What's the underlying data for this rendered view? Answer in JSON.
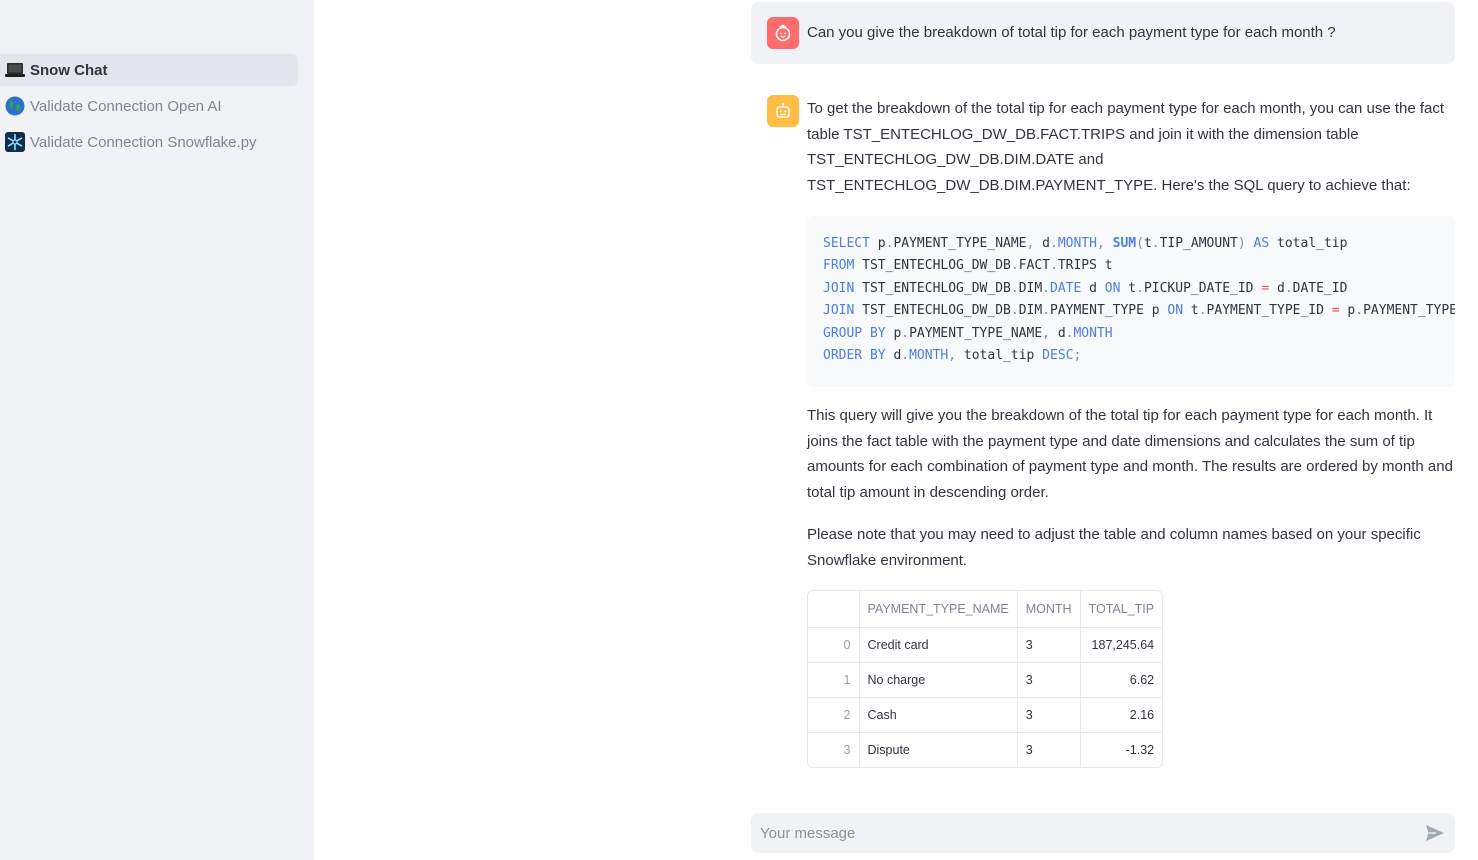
{
  "sidebar": {
    "items": [
      {
        "label": "Snow Chat",
        "icon": "laptop-icon",
        "active": true
      },
      {
        "label": "Validate Connection Open AI",
        "icon": "globe-icon",
        "active": false
      },
      {
        "label": "Validate Connection Snowflake.py",
        "icon": "snowflake-icon",
        "active": false
      }
    ]
  },
  "user_message": "Can you give the breakdown of total tip for each payment type for each month ?",
  "assistant": {
    "intro": "To get the breakdown of the total tip for each payment type for each month, you can use the fact table TST_ENTECHLOG_DW_DB.FACT.TRIPS and join it with the dimension table TST_ENTECHLOG_DW_DB.DIM.DATE and TST_ENTECHLOG_DW_DB.DIM.PAYMENT_TYPE. Here's the SQL query to achieve that:",
    "explanation": "This query will give you the breakdown of the total tip for each payment type for each month. It joins the fact table with the payment type and date dimensions and calculates the sum of tip amounts for each combination of payment type and month. The results are ordered by month and total tip amount in descending order.",
    "note": "Please note that you may need to adjust the table and column names based on your specific Snowflake environment."
  },
  "table": {
    "columns": [
      "",
      "PAYMENT_TYPE_NAME",
      "MONTH",
      "TOTAL_TIP"
    ],
    "rows": [
      [
        "0",
        "Credit card",
        "3",
        "187,245.64"
      ],
      [
        "1",
        "No charge",
        "3",
        "6.62"
      ],
      [
        "2",
        "Cash",
        "3",
        "2.16"
      ],
      [
        "3",
        "Dispute",
        "3",
        "-1.32"
      ]
    ]
  },
  "chat_input": {
    "placeholder": "Your message"
  },
  "colors": {
    "user_avatar": "#ff6c6c",
    "bot_avatar": "#ffbd45",
    "sidebar_bg": "#f0f2f6",
    "keyword": "#4e7ddb"
  }
}
